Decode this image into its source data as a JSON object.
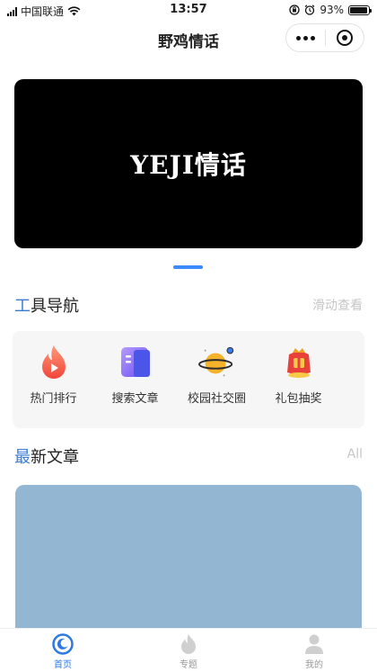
{
  "status_bar": {
    "carrier": "中国联通",
    "time": "13:57",
    "battery": "93%",
    "battery_level": 0.93
  },
  "nav": {
    "title": "野鸡情话"
  },
  "banner": {
    "text": "YEJI情话"
  },
  "tools_section": {
    "title_accent": "工",
    "title_rest": "具导航",
    "more": "滑动查看",
    "items": [
      {
        "label": "热门排行",
        "icon": "fire-icon"
      },
      {
        "label": "搜索文章",
        "icon": "book-icon"
      },
      {
        "label": "校园社交圈",
        "icon": "planet-icon"
      },
      {
        "label": "礼包抽奖",
        "icon": "gift-bag-icon"
      }
    ]
  },
  "articles_section": {
    "title_accent": "最",
    "title_rest": "新文章",
    "more": "All"
  },
  "tab_bar": {
    "tabs": [
      {
        "label": "首页",
        "icon": "home-icon",
        "active": true
      },
      {
        "label": "专题",
        "icon": "fire-icon",
        "active": false
      },
      {
        "label": "我的",
        "icon": "user-icon",
        "active": false
      }
    ]
  },
  "colors": {
    "accent": "#3a7bd5",
    "tab_active": "#2f79e0",
    "card": "#93b6d3",
    "banner": "#000000"
  }
}
